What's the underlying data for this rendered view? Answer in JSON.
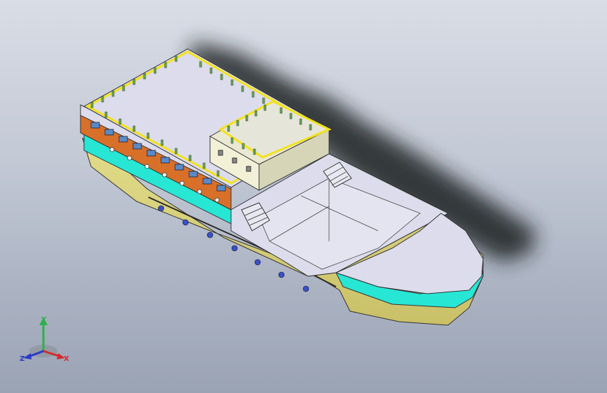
{
  "triad": {
    "x_label": "X",
    "y_label": "Y",
    "z_label": "Z"
  },
  "colors": {
    "background_top": "#d9dde6",
    "background_bottom": "#9aa3b4",
    "hull": "#d8d27a",
    "deck": "#dcdcec",
    "cyan_band": "#27e6d4",
    "orange_band": "#d8702a",
    "railing": "#f2e21c",
    "bollard": "#6fa55a",
    "shadow": "#1e2024"
  }
}
